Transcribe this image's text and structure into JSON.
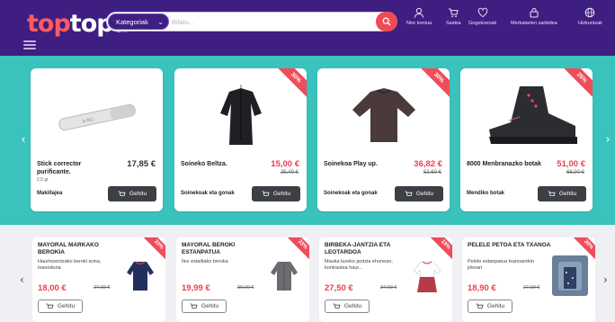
{
  "header": {
    "logo_part1": "top",
    "logo_part2": "topa",
    "category_label": "Kategoriak",
    "search_placeholder": "Bilatu...",
    "nav": [
      {
        "label": "Nire kontua",
        "icon": "user-icon"
      },
      {
        "label": "Saskia",
        "icon": "cart-icon"
      },
      {
        "label": "Gogokoenak",
        "icon": "heart-icon"
      },
      {
        "label": "Merkatarien sarbidea",
        "icon": "shop-lock-icon"
      },
      {
        "label": "Hizkuntzak",
        "icon": "globe-icon"
      }
    ]
  },
  "featured": [
    {
      "name": "Stick corrector purificante.",
      "sub": "2,5 gr",
      "price": "17,85 €",
      "old_price": "",
      "category": "Makillajea",
      "discount": "",
      "button": "Gehitu"
    },
    {
      "name": "Soineko Beltza.",
      "sub": "",
      "price": "15,00 €",
      "old_price": "25,40 €",
      "category": "Soinekoak eta gonak",
      "discount": "30%",
      "button": "Gehitu"
    },
    {
      "name": "Soinekoa Play up.",
      "sub": "",
      "price": "36,82 €",
      "old_price": "52,60 €",
      "category": "Soinekoak eta gonak",
      "discount": "30%",
      "button": "Gehitu"
    },
    {
      "name": "8000 Menbranazko botak",
      "sub": "",
      "price": "51,00 €",
      "old_price": "68,00 €",
      "category": "Mendiko botak",
      "discount": "25%",
      "button": "Gehitu"
    }
  ],
  "products": [
    {
      "name": "MAYORAL MARKAKO BEROKIA",
      "desc": "Haurtxoentzako beroki arina, txanoduna",
      "price": "18,00 €",
      "old_price": "27,00 €",
      "discount": "33%",
      "button": "Gehitu"
    },
    {
      "name": "MAYORAL BEROKI ESTANPATUA",
      "desc": "Ilez estalitako beroka",
      "price": "19,99 €",
      "old_price": "30,00 €",
      "discount": "33%",
      "button": "Gehitu"
    },
    {
      "name": "BIRBEKA-JANTZIA ETA LEOTARDOA",
      "desc": "Mauka luzeko jantzia ehunean, kontrastea haur...",
      "price": "27,50 €",
      "old_price": "34,00 €",
      "discount": "19%",
      "button": "Gehitu"
    },
    {
      "name": "PELELE PETOA ETA TXANOA",
      "desc": "Pelele estanpatua txanoarekin jokoan",
      "price": "18,90 €",
      "old_price": "27,00 €",
      "discount": "30%",
      "button": "Gehitu"
    }
  ],
  "colors": {
    "header_bg": "#3f1e82",
    "banner_bg": "#3ac2bd",
    "accent_red": "#ef3d4d",
    "logo_red": "#ff5a60"
  }
}
